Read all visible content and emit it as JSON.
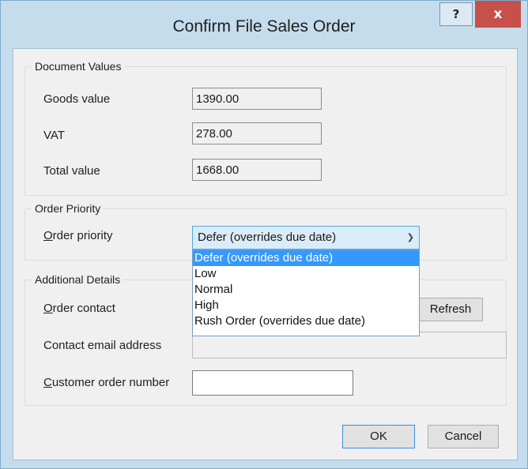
{
  "window": {
    "title": "Confirm File Sales Order",
    "help_glyph": "?",
    "close_glyph": "x"
  },
  "document_values": {
    "legend": "Document Values",
    "goods_label": "Goods value",
    "goods_value": "1390.00",
    "vat_label": "VAT",
    "vat_value": "278.00",
    "total_label": "Total value",
    "total_value": "1668.00"
  },
  "order_priority": {
    "legend": "Order Priority",
    "label_hotkey": "O",
    "label_rest": "rder priority",
    "selected": "Defer (overrides due date)",
    "options": [
      "Defer (overrides due date)",
      "Low",
      "Normal",
      "High",
      "Rush Order (overrides due date)"
    ]
  },
  "additional_details": {
    "legend": "Additional Details",
    "contact_label_hotkey": "O",
    "contact_label_rest": "rder contact",
    "refresh_label": "Refresh",
    "email_label": "Contact email address",
    "customer_label_hotkey": "C",
    "customer_label_rest": "ustomer order number",
    "customer_value": ""
  },
  "footer": {
    "ok_label": "OK",
    "cancel_label": "Cancel"
  },
  "icons": {
    "dropdown_arrow": "chevron-down-icon"
  }
}
